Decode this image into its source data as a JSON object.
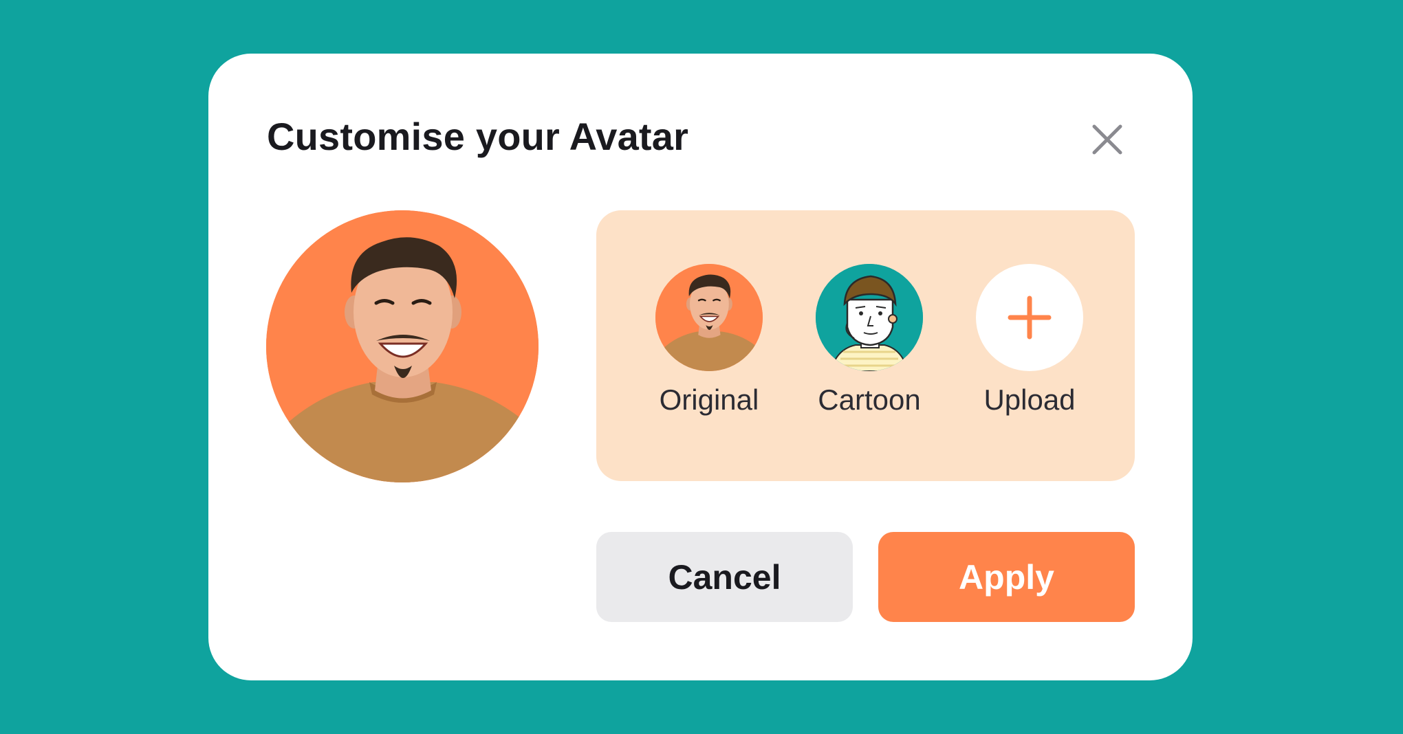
{
  "dialog": {
    "title": "Customise your Avatar",
    "close_icon": "close-icon"
  },
  "preview": {
    "avatar_icon": "smiling-man-photo",
    "background_color": "#FF844B"
  },
  "options": [
    {
      "label": "Original",
      "icon": "smiling-man-photo"
    },
    {
      "label": "Cartoon",
      "icon": "cartoon-man-illustration"
    },
    {
      "label": "Upload",
      "icon": "plus-icon"
    }
  ],
  "buttons": {
    "cancel_label": "Cancel",
    "apply_label": "Apply"
  },
  "colors": {
    "page_background": "#0FA39E",
    "accent": "#FF844B",
    "panel_background": "#FDE1C7",
    "cancel_background": "#EAEAEC"
  }
}
